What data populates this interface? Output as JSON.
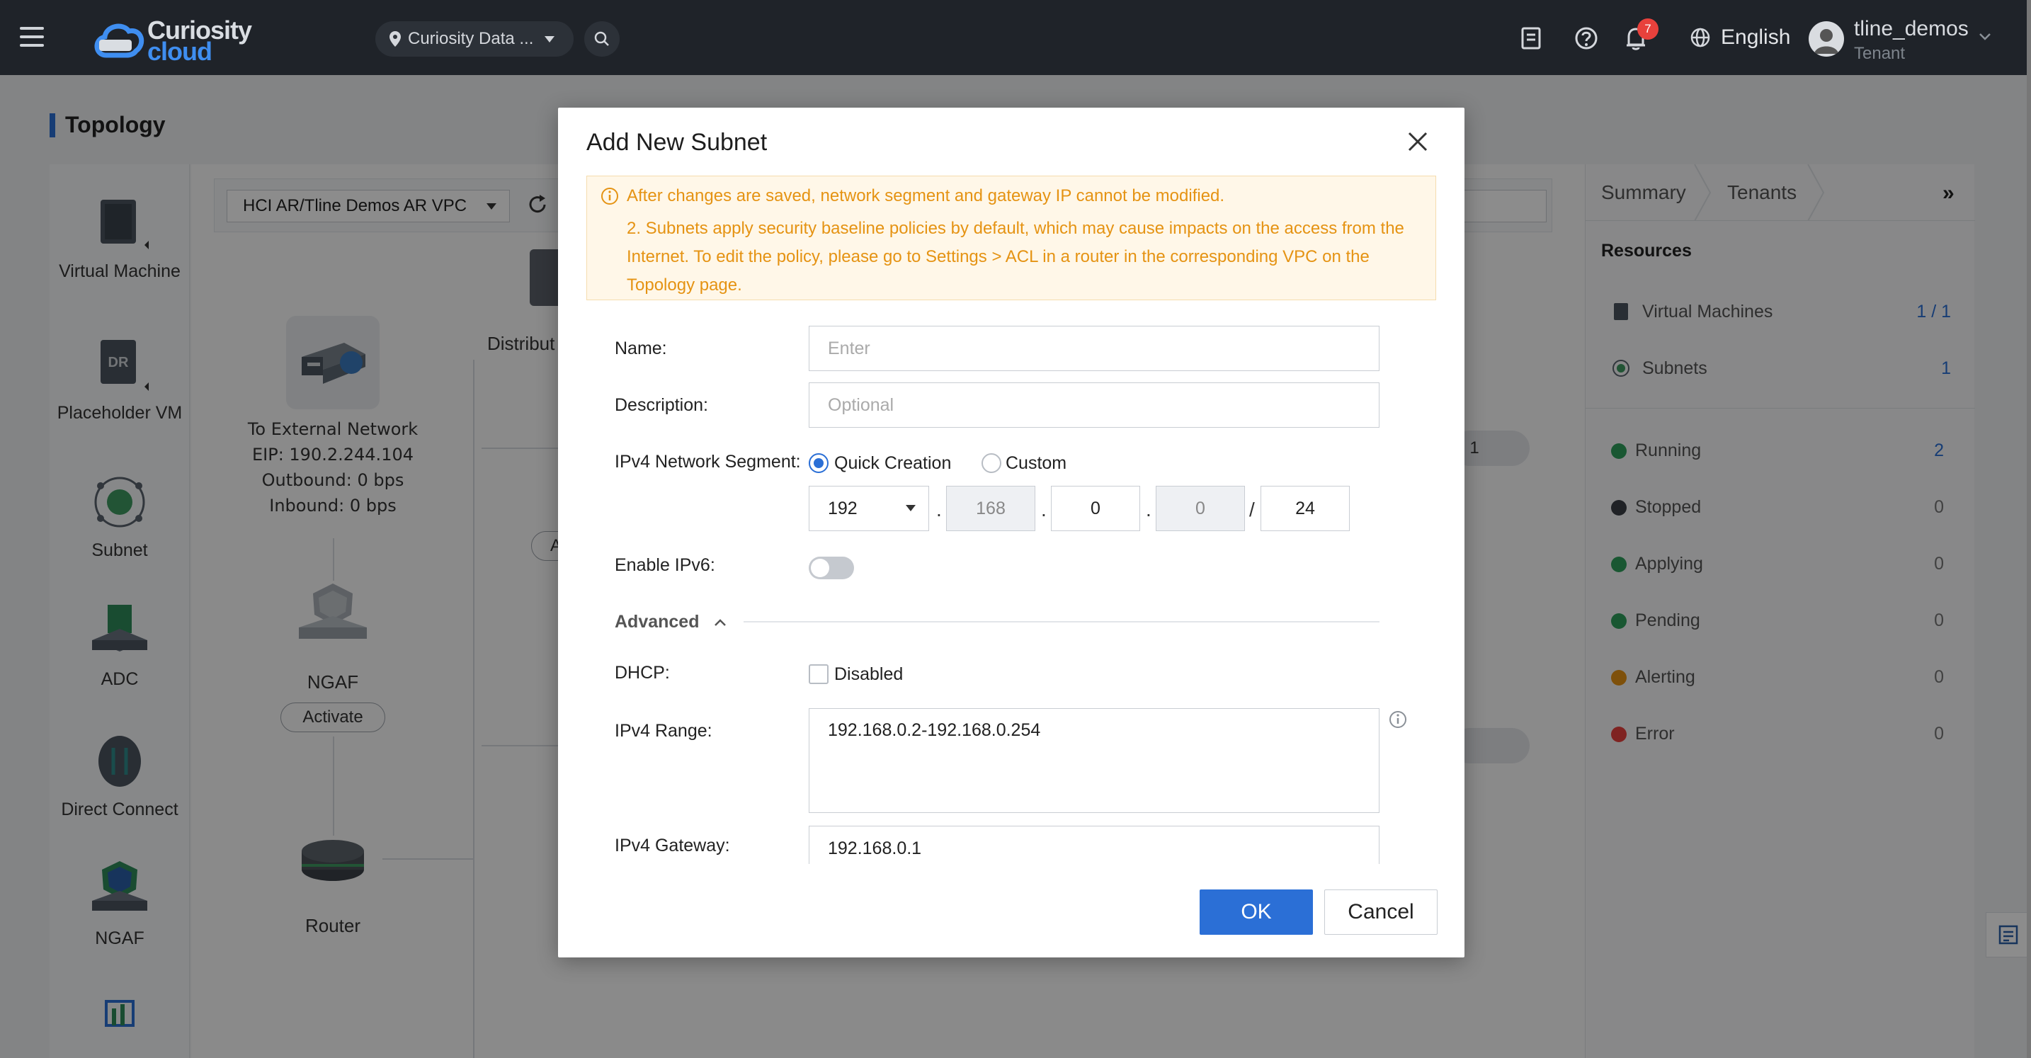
{
  "brand": {
    "line1": "Curiosity",
    "line2": "cloud"
  },
  "topbar": {
    "region": "Curiosity Data ...",
    "notification_count": "7",
    "language": "English",
    "user_name": "tline_demos",
    "user_role": "Tenant"
  },
  "page": {
    "title": "Topology"
  },
  "left_panel": {
    "items": [
      "Virtual Machine",
      "Placeholder VM",
      "Subnet",
      "ADC",
      "Direct Connect",
      "NGAF"
    ]
  },
  "canvas": {
    "vpc_select": "HCI AR/Tline Demos AR VPC",
    "external": {
      "title": "To External Network",
      "eip": "EIP: 190.2.244.104",
      "outbound": "Outbound: 0 bps",
      "inbound": "Inbound: 0 bps"
    },
    "ngaf_label": "NGAF",
    "activate_label": "Activate",
    "router_label": "Router",
    "dist_label": "Distribut",
    "pill_a": "A",
    "pill_right": ": 1"
  },
  "right_panel": {
    "tabs": [
      "Summary",
      "Tenants"
    ],
    "section": "Resources",
    "resources": [
      {
        "label": "Virtual Machines",
        "value": "1 / 1"
      },
      {
        "label": "Subnets",
        "value": "1"
      }
    ],
    "statuses": [
      {
        "label": "Running",
        "value": "2",
        "color": "#2e9e5b"
      },
      {
        "label": "Stopped",
        "value": "0",
        "color": "#3b3f46"
      },
      {
        "label": "Applying",
        "value": "0",
        "color": "#2e9e5b"
      },
      {
        "label": "Pending",
        "value": "0",
        "color": "#2e9e5b"
      },
      {
        "label": "Alerting",
        "value": "0",
        "color": "#e59313"
      },
      {
        "label": "Error",
        "value": "0",
        "color": "#e8413c"
      }
    ]
  },
  "modal": {
    "title": "Add New Subnet",
    "warning_line1": "After changes are saved, network segment and gateway IP cannot be modified.",
    "warning_line2": "2. Subnets apply security baseline policies by default, which may cause impacts on the access from the Internet. To edit the policy, please go to Settings > ACL in a router in the corresponding VPC on the Topology page.",
    "name_label": "Name:",
    "name_placeholder": "Enter",
    "desc_label": "Description:",
    "desc_placeholder": "Optional",
    "segment_label": "IPv4 Network Segment:",
    "quick_creation": "Quick Creation",
    "custom": "Custom",
    "octet1": "192",
    "octet2": "168",
    "octet3": "0",
    "octet4": "0",
    "prefix": "24",
    "ipv6_label": "Enable IPv6:",
    "advanced_label": "Advanced",
    "dhcp_label": "DHCP:",
    "dhcp_option": "Disabled",
    "range_label": "IPv4 Range:",
    "range_value": "192.168.0.2-192.168.0.254",
    "gateway_label": "IPv4 Gateway:",
    "gateway_value": "192.168.0.1",
    "ok": "OK",
    "cancel": "Cancel"
  },
  "colors": {
    "accent": "#2b6fd6",
    "warning": "#e59313",
    "topbar": "#1f2329"
  }
}
